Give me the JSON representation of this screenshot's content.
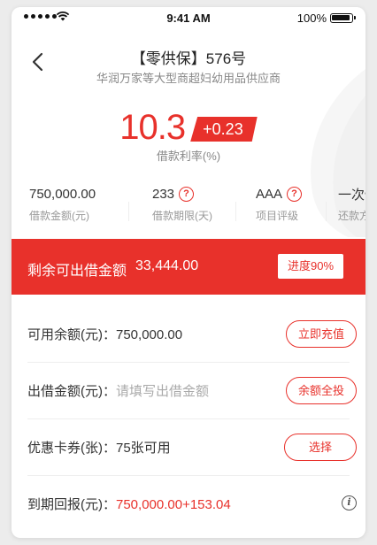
{
  "status_bar": {
    "time": "9:41 AM",
    "battery": "100%"
  },
  "nav": {
    "title": "【零供保】576号",
    "subtitle": "华润万家等大型商超妇幼用品供应商"
  },
  "rate": {
    "value": "10.3",
    "delta": "+0.23",
    "label": "借款利率(%)"
  },
  "stats": [
    {
      "value": "750,000.00",
      "label": "借款金额(元)",
      "has_help": false
    },
    {
      "value": "233",
      "label": "借款期限(天)",
      "has_help": true
    },
    {
      "value": "AAA",
      "label": "项目评级",
      "has_help": true
    },
    {
      "value": "一次性",
      "label": "还款方式",
      "has_help": false
    }
  ],
  "banner": {
    "label": "剩余可出借金额",
    "value": "33,444.00",
    "button": "进度90%"
  },
  "form": {
    "available": {
      "label": "可用余额(元)：",
      "value": "750,000.00",
      "button": "立即充值"
    },
    "amount": {
      "label": "出借金额(元)：",
      "placeholder": "请填写出借金额",
      "button": "余额全投"
    },
    "coupon": {
      "label": "优惠卡券(张)：",
      "value": "75张可用",
      "button": "选择"
    },
    "return": {
      "label": "到期回报(元)：",
      "value": "750,000.00+153.04"
    }
  },
  "icons": {
    "back": "chevron-left-icon",
    "help": "question-circle-icon",
    "info": "info-circle-icon",
    "signal": "signal-icon",
    "wifi": "wifi-icon",
    "battery": "battery-icon"
  },
  "colors": {
    "accent": "#e8312b",
    "muted": "#888888",
    "placeholder": "#aaaaaa"
  }
}
